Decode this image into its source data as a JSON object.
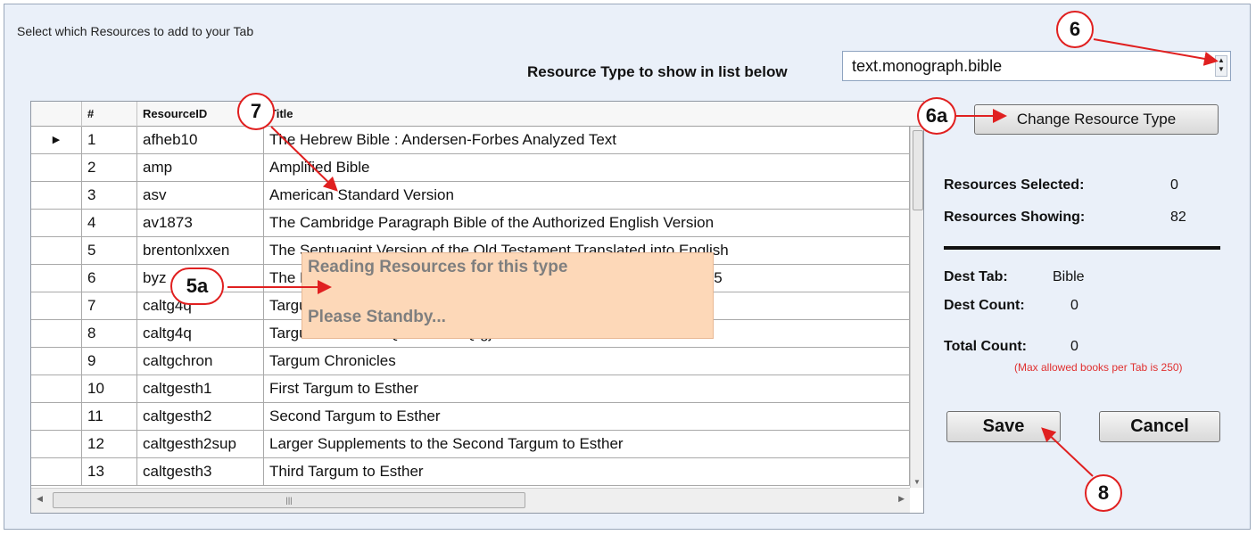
{
  "dialog": {
    "title": "Select which Resources to add to your Tab",
    "resource_type_label": "Resource Type to show in list below",
    "resource_type_value": "text.monograph.bible",
    "change_button": "Change Resource Type",
    "save_button": "Save",
    "cancel_button": "Cancel"
  },
  "grid": {
    "columns": [
      "#",
      "ResourceID",
      "Title"
    ],
    "current_row_marker": "▶",
    "rows": [
      {
        "num": "1",
        "id": "afheb10",
        "title": "The Hebrew Bible : Andersen-Forbes Analyzed Text"
      },
      {
        "num": "2",
        "id": "amp",
        "title": "Amplified Bible"
      },
      {
        "num": "3",
        "id": "asv",
        "title": "American Standard Version"
      },
      {
        "num": "4",
        "id": "av1873",
        "title": "The Cambridge Paragraph Bible of the Authorized English Version"
      },
      {
        "num": "5",
        "id": "brentonlxxen",
        "title": "The Septuagint Version of the Old Testament Translated into English"
      },
      {
        "num": "6",
        "id": "byz",
        "title": "The New Testament in the Original Greek: Byzantine Textform 2005"
      },
      {
        "num": "7",
        "id": "caltg4q",
        "title": "Targum"
      },
      {
        "num": "8",
        "id": "caltg4q",
        "title": "Targum Job from Qumran - 4Qtgjob"
      },
      {
        "num": "9",
        "id": "caltgchron",
        "title": "Targum Chronicles"
      },
      {
        "num": "10",
        "id": "caltgesth1",
        "title": "First Targum to Esther"
      },
      {
        "num": "11",
        "id": "caltgesth2",
        "title": "Second Targum to Esther"
      },
      {
        "num": "12",
        "id": "caltgesth2sup",
        "title": "Larger Supplements to the Second Targum to Esther"
      },
      {
        "num": "13",
        "id": "caltgesth3",
        "title": "Third Targum to Esther"
      }
    ]
  },
  "loading": {
    "line1": "Reading Resources for this type",
    "line2": "Please Standby..."
  },
  "stats": {
    "selected_label": "Resources Selected:",
    "selected_value": "0",
    "showing_label": "Resources Showing:",
    "showing_value": "82",
    "dest_tab_label": "Dest Tab:",
    "dest_tab_value": "Bible",
    "dest_count_label": "Dest Count:",
    "dest_count_value": "0",
    "total_count_label": "Total Count:",
    "total_count_value": "0",
    "max_note": "(Max allowed books per Tab is 250)"
  },
  "callouts": {
    "c6": "6",
    "c6a": "6a",
    "c7": "7",
    "c5a": "5a",
    "c8": "8"
  },
  "colors": {
    "window_bg": "#eaf0f9",
    "loading_bg": "#fdd8b8",
    "callout_red": "#e02020",
    "note_red": "#e03030"
  }
}
